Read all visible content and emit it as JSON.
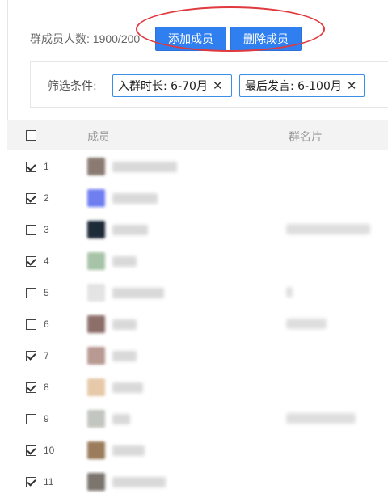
{
  "header": {
    "member_count_label": "群成员人数: 1900/200",
    "add_button": "添加成员",
    "delete_button": "删除成员"
  },
  "filter": {
    "label": "筛选条件:",
    "tags": [
      {
        "text": "入群时长:  6-70月",
        "remove": "✕"
      },
      {
        "text": "最后发言:  6-100月",
        "remove": "✕"
      }
    ]
  },
  "table": {
    "columns": {
      "member": "成员",
      "card": "群名片"
    },
    "rows": [
      {
        "index": "1",
        "checked": true,
        "avatar_color": "#8a7a72",
        "nick_width": 80,
        "card_width": 0
      },
      {
        "index": "2",
        "checked": true,
        "avatar_color": "#6f7ff0",
        "nick_width": 56,
        "card_width": 0
      },
      {
        "index": "3",
        "checked": false,
        "avatar_color": "#1d2a38",
        "nick_width": 44,
        "card_width": 104
      },
      {
        "index": "4",
        "checked": true,
        "avatar_color": "#a8c4a8",
        "nick_width": 30,
        "card_width": 0
      },
      {
        "index": "5",
        "checked": false,
        "avatar_color": "#e4e4e4",
        "nick_width": 64,
        "card_width": 8
      },
      {
        "index": "6",
        "checked": false,
        "avatar_color": "#8d6f6a",
        "nick_width": 30,
        "card_width": 50
      },
      {
        "index": "7",
        "checked": true,
        "avatar_color": "#b89a92",
        "nick_width": 30,
        "card_width": 0
      },
      {
        "index": "8",
        "checked": true,
        "avatar_color": "#e6c9a9",
        "nick_width": 38,
        "card_width": 0
      },
      {
        "index": "9",
        "checked": false,
        "avatar_color": "#c3c6c0",
        "nick_width": 22,
        "card_width": 86
      },
      {
        "index": "10",
        "checked": true,
        "avatar_color": "#9b7c5c",
        "nick_width": 40,
        "card_width": 0
      },
      {
        "index": "11",
        "checked": true,
        "avatar_color": "#7b756e",
        "nick_width": 66,
        "card_width": 0
      }
    ]
  },
  "colors": {
    "primary": "#2f7ff0",
    "annotation": "#e0393e",
    "tag_border": "#3a8ee6"
  }
}
